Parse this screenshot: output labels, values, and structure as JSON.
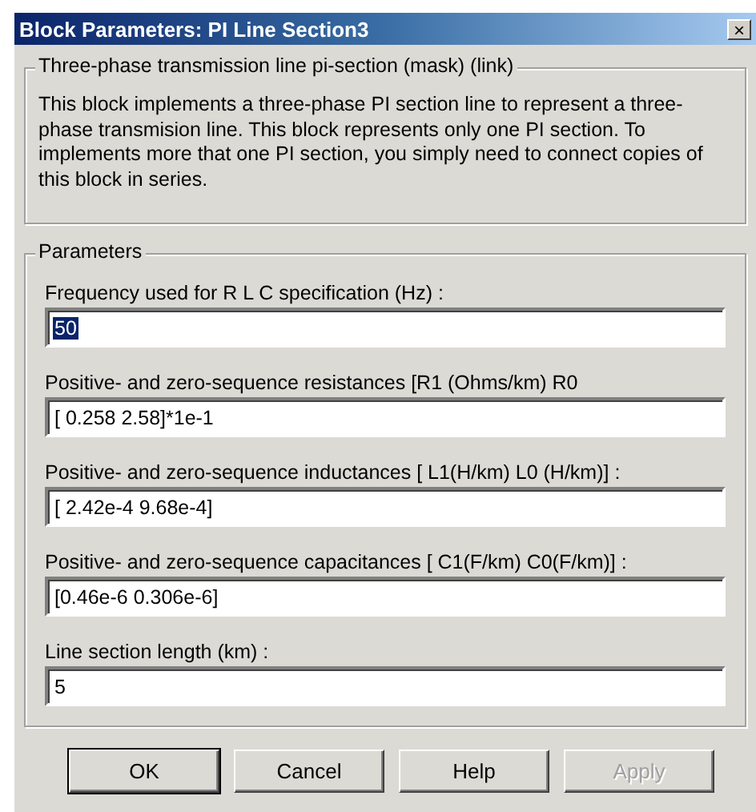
{
  "window": {
    "title": "Block Parameters: PI Line Section3",
    "close": "×"
  },
  "description": {
    "title": "Three-phase transmission line pi-section (mask) (link)",
    "text": "This block implements a three-phase PI section line to represent a three-phase transmision line. This block represents only  one PI section. To implements more that one PI section,  you  simply need to connect copies of this block in series."
  },
  "parameters": {
    "title": "Parameters",
    "fields": [
      {
        "label": "Frequency used for R L C specification (Hz) :",
        "value": "50",
        "text_selected": true
      },
      {
        "label": "Positive- and zero-sequence resistances  [R1 (Ohms/km)  R0",
        "value": "[ 0.258 2.58]*1e-1",
        "text_selected": false
      },
      {
        "label": "Positive- and zero-sequence inductances [ L1(H/km)  L0 (H/km)] :",
        "value": "[ 2.42e-4 9.68e-4]",
        "text_selected": false
      },
      {
        "label": "Positive- and zero-sequence capacitances [ C1(F/km) C0(F/km)] :",
        "value": "[0.46e-6 0.306e-6]",
        "text_selected": false
      },
      {
        "label": "Line section length (km) :",
        "value": "5",
        "text_selected": false
      }
    ]
  },
  "buttons": [
    {
      "label": "OK",
      "default": true,
      "disabled": false
    },
    {
      "label": "Cancel",
      "default": false,
      "disabled": false
    },
    {
      "label": "Help",
      "default": false,
      "disabled": false
    },
    {
      "label": "Apply",
      "default": false,
      "disabled": true
    }
  ]
}
